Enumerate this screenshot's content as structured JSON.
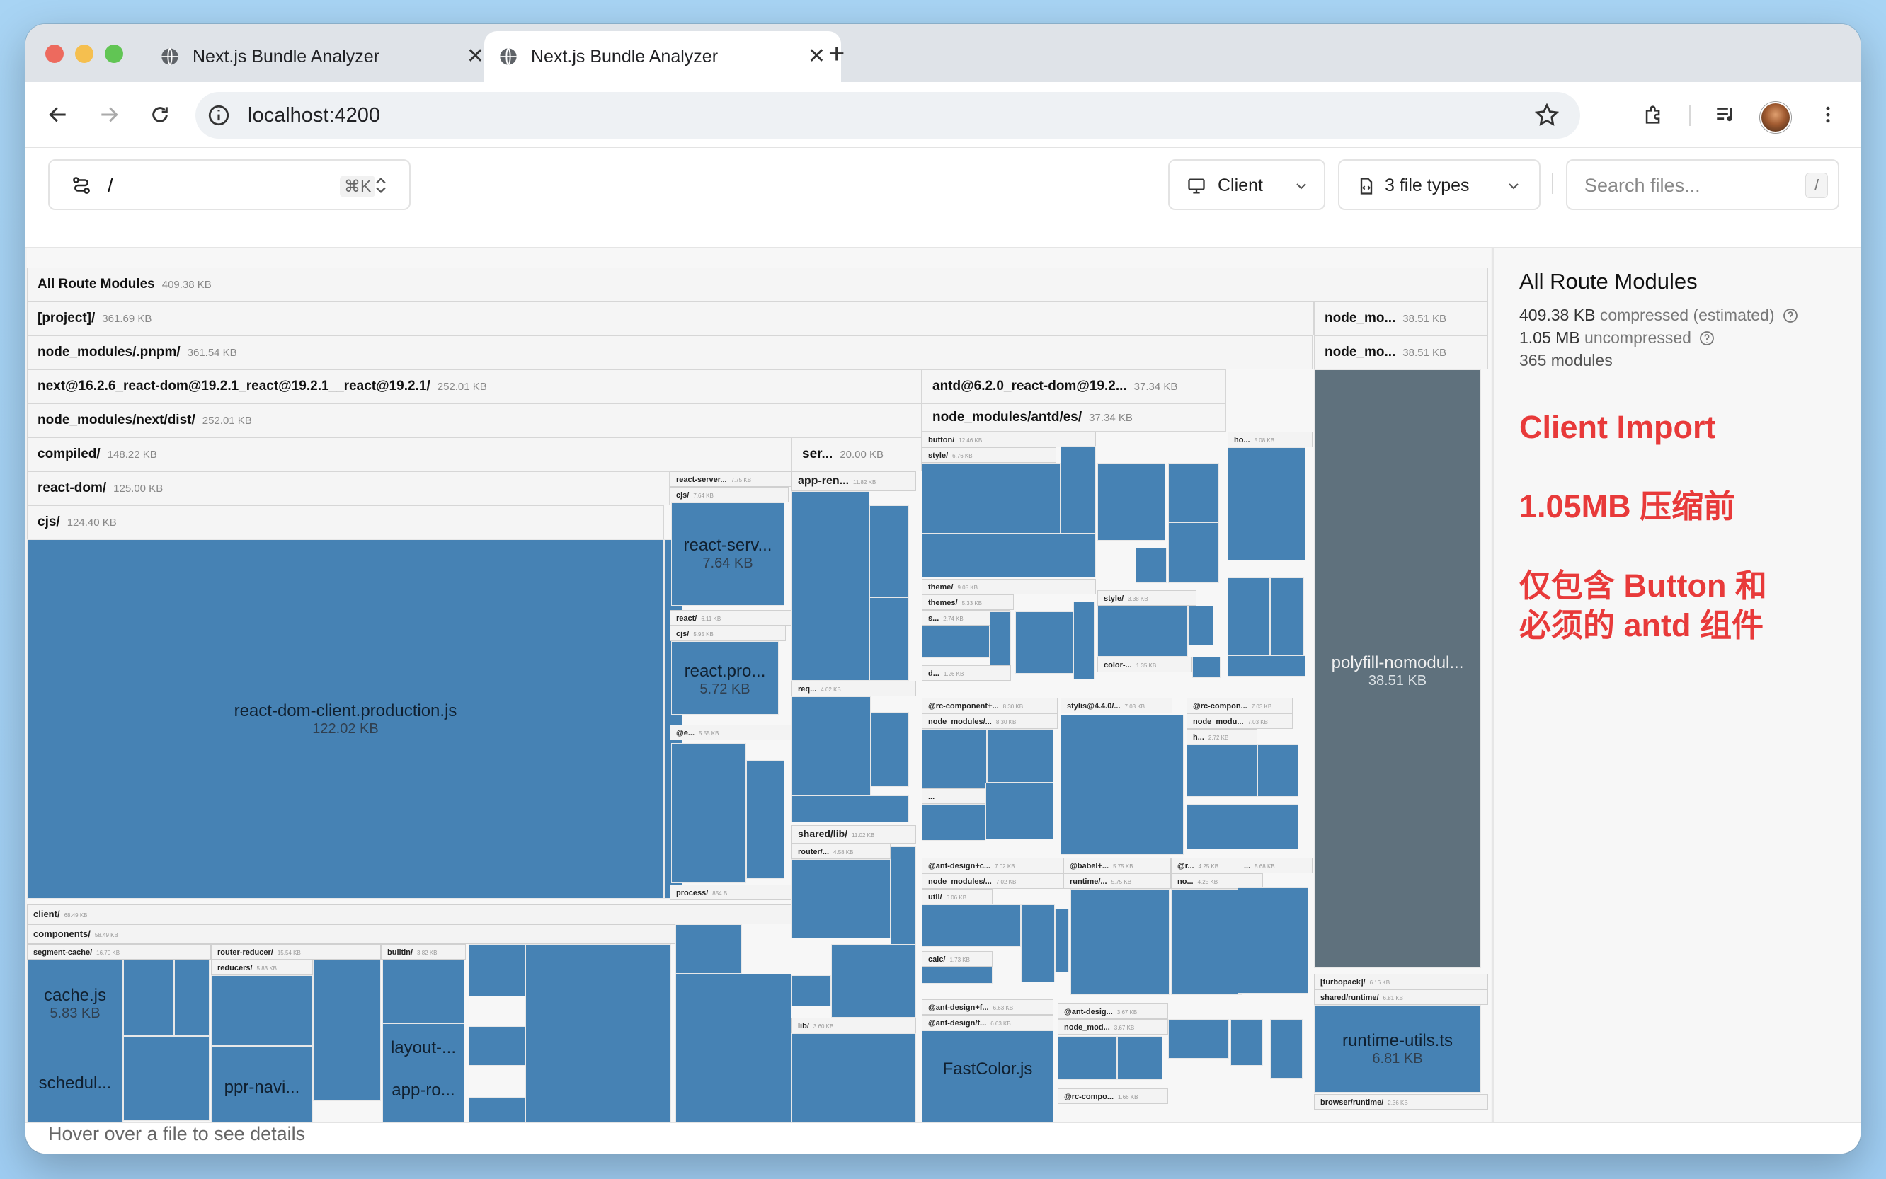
{
  "browser": {
    "tabs": [
      {
        "title": "Next.js Bundle Analyzer"
      },
      {
        "title": "Next.js Bundle Analyzer"
      }
    ],
    "url": "localhost:4200"
  },
  "app": {
    "route": {
      "value": "/",
      "shortcut": "⌘K"
    },
    "environment": "Client",
    "file_types": "3 file types",
    "search": {
      "placeholder": "Search files...",
      "shortcut": "/"
    }
  },
  "treemap": {
    "root": {
      "name": "All Route Modules",
      "size": "409.38 KB"
    },
    "project": {
      "name": "[project]/",
      "size": "361.69 KB"
    },
    "pnpm": {
      "name": "node_modules/.pnpm/",
      "size": "361.54 KB"
    },
    "nextpkg": {
      "name": "next@16.2.6_react-dom@19.2.1_react@19.2.1__react@19.2.1/",
      "size": "252.01 KB"
    },
    "nextdist": {
      "name": "node_modules/next/dist/",
      "size": "252.01 KB"
    },
    "compiled": {
      "name": "compiled/",
      "size": "148.22 KB"
    },
    "reactdom": {
      "name": "react-dom/",
      "size": "125.00 KB"
    },
    "cjs": {
      "name": "cjs/",
      "size": "124.40 KB"
    },
    "reactdomclient": {
      "name": "react-dom-client.production.js",
      "size": "122.02 KB"
    },
    "server": {
      "name": "ser...",
      "size": "20.00 KB"
    },
    "appren": {
      "name": "app-ren...",
      "size": "11.82 KB"
    },
    "reactserver": {
      "name": "react-server...",
      "size": "7.75 KB"
    },
    "reactserv_cjs": {
      "name": "cjs/",
      "size": "7.64 KB"
    },
    "reactserv_file": {
      "name": "react-serv...",
      "size": "7.64 KB"
    },
    "react": {
      "name": "react/",
      "size": "6.11 KB"
    },
    "react_cjs": {
      "name": "cjs/",
      "size": "5.95 KB"
    },
    "reactpro": {
      "name": "react.pro...",
      "size": "5.72 KB"
    },
    "e": {
      "name": "@e...",
      "size": "5.55 KB"
    },
    "process": {
      "name": "process/",
      "size": "854 B"
    },
    "req": {
      "name": "req...",
      "size": "4.02 KB"
    },
    "sharedlib": {
      "name": "shared/lib/",
      "size": "11.02 KB"
    },
    "router": {
      "name": "router/...",
      "size": "4.58 KB"
    },
    "lib": {
      "name": "lib/",
      "size": "3.60 KB"
    },
    "client": {
      "name": "client/",
      "size": "68.49 KB"
    },
    "components": {
      "name": "components/",
      "size": "58.49 KB"
    },
    "segcache": {
      "name": "segment-cache/",
      "size": "16.70 KB"
    },
    "cachejs": {
      "name": "cache.js",
      "size": "5.83 KB"
    },
    "schedul": {
      "name": "schedul..."
    },
    "routerreducer": {
      "name": "router-reducer/",
      "size": "15.54 KB"
    },
    "reducers": {
      "name": "reducers/",
      "size": "5.83 KB"
    },
    "ppr": {
      "name": "ppr-navi..."
    },
    "builtin": {
      "name": "builtin/",
      "size": "3.82 KB"
    },
    "layout": {
      "name": "layout-..."
    },
    "appro": {
      "name": "app-ro..."
    },
    "antdpkg": {
      "name": "antd@6.2.0_react-dom@19.2...",
      "size": "37.34 KB"
    },
    "antdes": {
      "name": "node_modules/antd/es/",
      "size": "37.34 KB"
    },
    "button": {
      "name": "button/",
      "size": "12.46 KB"
    },
    "style": {
      "name": "style/",
      "size": "6.76 KB"
    },
    "theme": {
      "name": "theme/",
      "size": "9.05 KB"
    },
    "themes": {
      "name": "themes/",
      "size": "5.33 KB"
    },
    "s": {
      "name": "s...",
      "size": "2.74 KB"
    },
    "d": {
      "name": "d...",
      "size": "1.26 KB"
    },
    "style2": {
      "name": "style/",
      "size": "3.38 KB"
    },
    "color": {
      "name": "color-...",
      "size": "1.35 KB"
    },
    "ho": {
      "name": "ho...",
      "size": "5.08 KB"
    },
    "rccomponent": {
      "name": "@rc-component+...",
      "size": "8.30 KB"
    },
    "nodemodules1": {
      "name": "node_modules/...",
      "size": "8.30 KB"
    },
    "stylis": {
      "name": "stylis@4.4.0/...",
      "size": "7.03 KB"
    },
    "rccompon2": {
      "name": "@rc-compon...",
      "size": "7.03 KB"
    },
    "nodemodu": {
      "name": "node_modu...",
      "size": "7.03 KB"
    },
    "h": {
      "name": "h...",
      "size": "2.72 KB"
    },
    "antdesign": {
      "name": "@ant-design+c...",
      "size": "7.02 KB"
    },
    "nodemodules2": {
      "name": "node_modules/...",
      "size": "7.02 KB"
    },
    "util": {
      "name": "util/",
      "size": "6.06 KB"
    },
    "calc": {
      "name": "calc/",
      "size": "1.73 KB"
    },
    "babel": {
      "name": "@babel+...",
      "size": "5.75 KB"
    },
    "runtime": {
      "name": "runtime/...",
      "size": "5.75 KB"
    },
    "r": {
      "name": "@r...",
      "size": "4.25 KB"
    },
    "no": {
      "name": "no...",
      "size": "4.25 KB"
    },
    "dots1": {
      "name": "...",
      "size": "5.68 KB"
    },
    "dots2": {
      "name": "...",
      "size": "5.68 KB"
    },
    "antdesignf": {
      "name": "@ant-design+f...",
      "size": "6.63 KB"
    },
    "antdesignf2": {
      "name": "@ant-design/f...",
      "size": "6.63 KB"
    },
    "fastcolor": {
      "name": "FastColor.js"
    },
    "antdesig3": {
      "name": "@ant-desig...",
      "size": "3.67 KB"
    },
    "nodemod3": {
      "name": "node_mod...",
      "size": "3.67 KB"
    },
    "rccompo3": {
      "name": "@rc-compo...",
      "size": "1.66 KB"
    },
    "polyfillpkg1": {
      "name": "node_mo...",
      "size": "38.51 KB"
    },
    "polyfillpkg2": {
      "name": "node_mo...",
      "size": "38.51 KB"
    },
    "polyfill": {
      "name": "polyfill-nomodul...",
      "size": "38.51 KB"
    },
    "turbopack": {
      "name": "[turbopack]/",
      "size": "6.16 KB"
    },
    "sharedruntime": {
      "name": "shared/runtime/",
      "size": "6.81 KB"
    },
    "runtimeutils": {
      "name": "runtime-utils.ts",
      "size": "6.81 KB"
    },
    "browserruntime": {
      "name": "browser/runtime/",
      "size": "2.36 KB"
    }
  },
  "sidebar": {
    "title": "All Route Modules",
    "compressed_value": "409.38 KB",
    "compressed_label": "compressed (estimated)",
    "uncompressed_value": "1.05 MB",
    "uncompressed_label": "uncompressed",
    "modules": "365 modules",
    "annotation1": "Client Import",
    "annotation2": "1.05MB 压缩前",
    "annotation3a": "仅包含 Button 和",
    "annotation3b": "必须的 antd 组件"
  },
  "footer": {
    "hint": "Hover over a file to see details"
  },
  "colors": {
    "block": "#4682b4",
    "polyfill": "#5f717d",
    "annotation": "#e83a3a"
  }
}
